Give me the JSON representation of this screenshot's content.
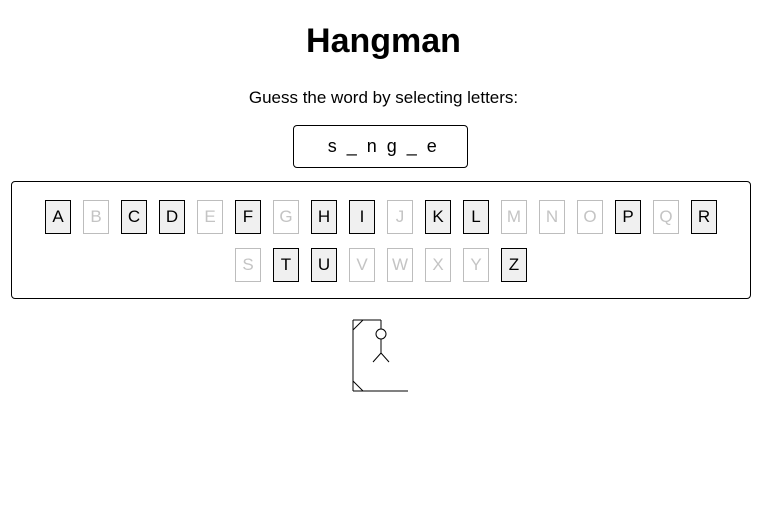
{
  "app": {
    "title": "Hangman"
  },
  "instructions": "Guess the word by selecting letters:",
  "word_display": "s_ng_e",
  "keyboard": {
    "rows": [
      [
        {
          "letter": "A",
          "used": false
        },
        {
          "letter": "B",
          "used": true
        },
        {
          "letter": "C",
          "used": false
        },
        {
          "letter": "D",
          "used": false
        },
        {
          "letter": "E",
          "used": true
        },
        {
          "letter": "F",
          "used": false
        },
        {
          "letter": "G",
          "used": true
        },
        {
          "letter": "H",
          "used": false
        },
        {
          "letter": "I",
          "used": false
        },
        {
          "letter": "J",
          "used": true
        },
        {
          "letter": "K",
          "used": false
        },
        {
          "letter": "L",
          "used": false
        },
        {
          "letter": "M",
          "used": true
        },
        {
          "letter": "N",
          "used": true
        },
        {
          "letter": "O",
          "used": true
        },
        {
          "letter": "P",
          "used": false
        },
        {
          "letter": "Q",
          "used": true
        },
        {
          "letter": "R",
          "used": false
        }
      ],
      [
        {
          "letter": "S",
          "used": true
        },
        {
          "letter": "T",
          "used": false
        },
        {
          "letter": "U",
          "used": false
        },
        {
          "letter": "V",
          "used": true
        },
        {
          "letter": "W",
          "used": true
        },
        {
          "letter": "X",
          "used": true
        },
        {
          "letter": "Y",
          "used": true
        },
        {
          "letter": "Z",
          "used": false
        }
      ]
    ]
  },
  "hangman": {
    "parts_shown": [
      "gallows",
      "rope",
      "head",
      "body",
      "left-leg",
      "right-leg"
    ]
  },
  "colors": {
    "key_available_bg": "#f0f0f0",
    "key_used_text": "#c4c4c4",
    "key_used_border": "#bdbdbd"
  }
}
